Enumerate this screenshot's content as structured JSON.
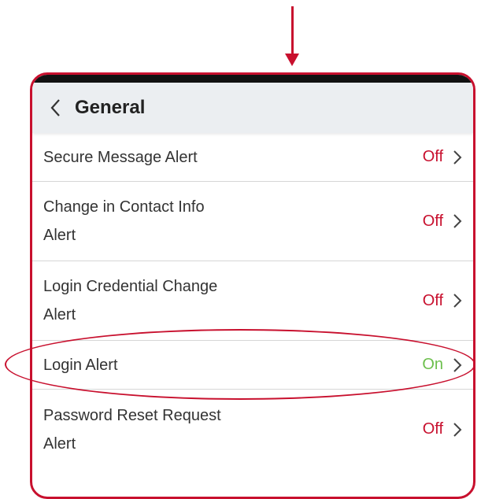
{
  "header": {
    "title": "General"
  },
  "icons": {
    "back": "chevron-left-icon",
    "row_chevron": "chevron-right-icon"
  },
  "colors": {
    "accent": "#c8102e",
    "off": "#c8102e",
    "on": "#6cbf4c"
  },
  "rows": [
    {
      "label_line1": "Secure Message Alert",
      "label_line2": "",
      "status": "Off"
    },
    {
      "label_line1": "Change in Contact Info",
      "label_line2": "Alert",
      "status": "Off"
    },
    {
      "label_line1": "Login Credential Change",
      "label_line2": "Alert",
      "status": "Off"
    },
    {
      "label_line1": "Login Alert",
      "label_line2": "",
      "status": "On"
    },
    {
      "label_line1": "Password Reset Request",
      "label_line2": "Alert",
      "status": "Off"
    }
  ]
}
